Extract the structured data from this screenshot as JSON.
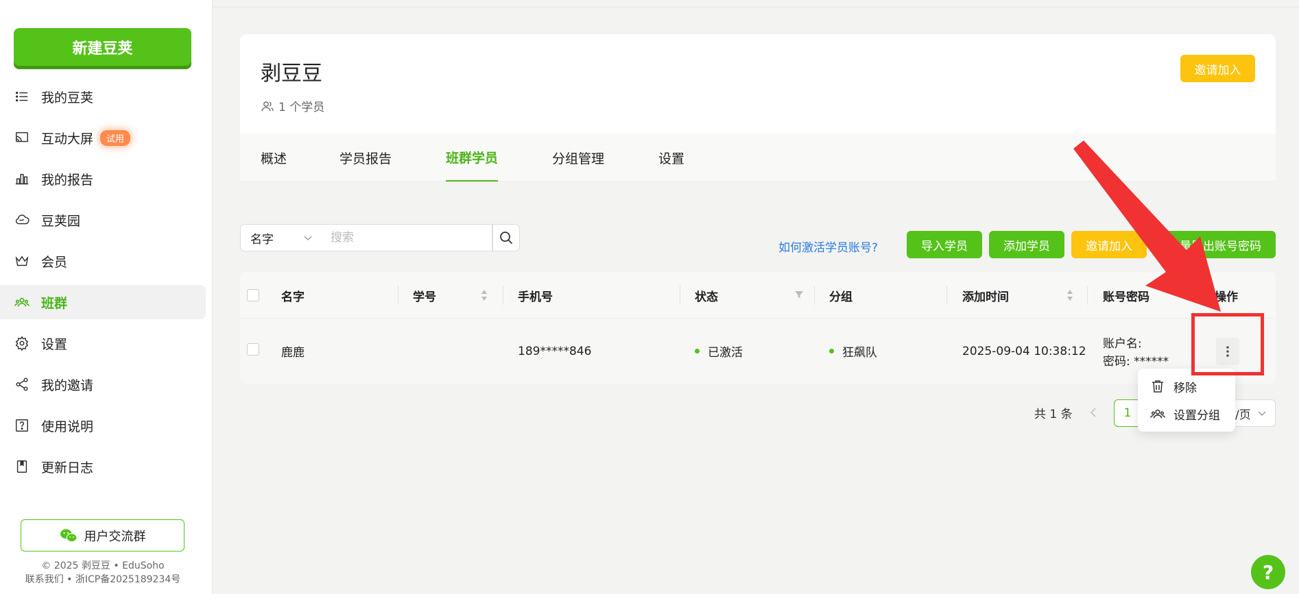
{
  "sidebar": {
    "new_button": "新建豆荚",
    "items": [
      {
        "label": "我的豆荚",
        "icon": "list-icon"
      },
      {
        "label": "互动大屏",
        "icon": "cast-screen-icon",
        "badge": "试用"
      },
      {
        "label": "我的报告",
        "icon": "bar-chart-icon"
      },
      {
        "label": "豆荚园",
        "icon": "cloud-icon"
      },
      {
        "label": "会员",
        "icon": "crown-icon"
      },
      {
        "label": "班群",
        "icon": "group-icon",
        "active": true
      },
      {
        "label": "设置",
        "icon": "gear-icon"
      },
      {
        "label": "我的邀请",
        "icon": "share-icon"
      },
      {
        "label": "使用说明",
        "icon": "help-square-icon"
      },
      {
        "label": "更新日志",
        "icon": "book-icon"
      }
    ],
    "group_button": "用户交流群",
    "footer_line1": "© 2025 剥豆豆 • EduSoho",
    "footer_line2": "联系我们 • 浙ICP备2025189234号"
  },
  "class": {
    "title": "剥豆豆",
    "member_count": "1 个学员",
    "invite_button": "邀请加入"
  },
  "tabs": [
    {
      "label": "概述"
    },
    {
      "label": "学员报告"
    },
    {
      "label": "班群学员",
      "active": true
    },
    {
      "label": "分组管理"
    },
    {
      "label": "设置"
    }
  ],
  "toolbar": {
    "filter_value": "名字",
    "search_placeholder": "搜索",
    "howto_link": "如何激活学员账号?",
    "import_button": "导入学员",
    "add_button": "添加学员",
    "invite_button": "邀请加入",
    "export_button": "批量导出账号密码"
  },
  "table": {
    "columns": {
      "name": "名字",
      "student_no": "学号",
      "phone": "手机号",
      "status": "状态",
      "group": "分组",
      "added_time": "添加时间",
      "account": "账号密码",
      "actions": "操作"
    },
    "rows": [
      {
        "name": "鹿鹿",
        "student_no": "",
        "phone": "189*****846",
        "status": "已激活",
        "group": "狂飙队",
        "added_time": "2025-09-04 10:38:12",
        "account_name": "账户名:",
        "password": "密码: ******"
      }
    ]
  },
  "pagination": {
    "total": "共 1 条",
    "current_page": "1",
    "page_size": "/页"
  },
  "row_menu": {
    "remove": "移除",
    "set_group": "设置分组"
  },
  "help_button": "?",
  "colors": {
    "brand_green": "#55c21a",
    "accent_yellow": "#fcc40e",
    "link_blue": "#2a7de1",
    "annotation_red": "#f03232"
  }
}
